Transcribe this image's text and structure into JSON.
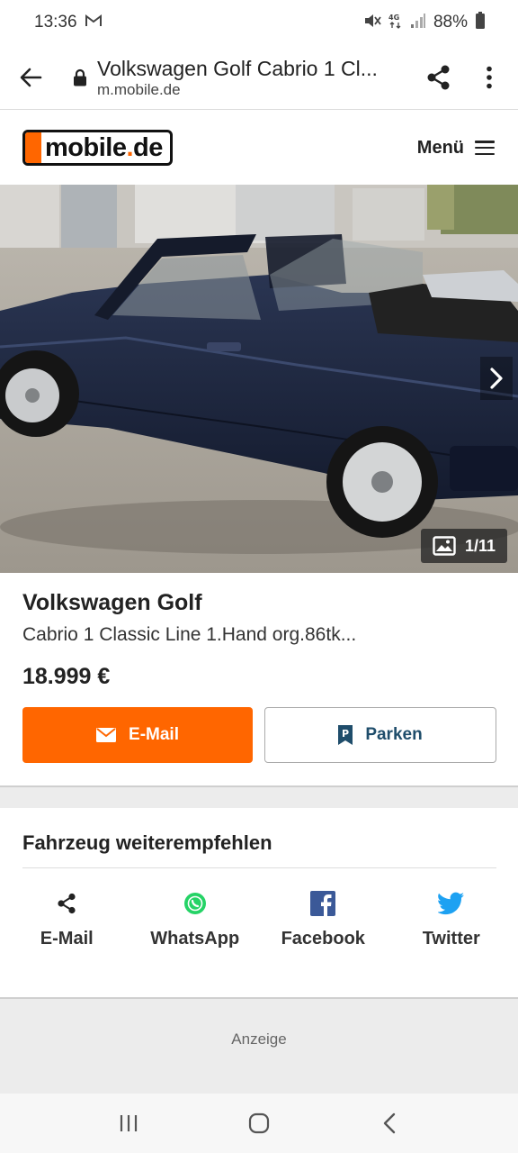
{
  "status_bar": {
    "time": "13:36",
    "battery": "88%",
    "icons": [
      "gmail-icon",
      "mute-icon",
      "4g-icon",
      "signal-icon",
      "battery-icon"
    ]
  },
  "browser": {
    "page_title": "Volkswagen Golf Cabrio 1 Cl...",
    "domain": "m.mobile.de",
    "icons": [
      "back-arrow-icon",
      "lock-icon",
      "share-icon",
      "more-vert-icon"
    ]
  },
  "site_header": {
    "logo_main": "mobile",
    "logo_dot": ".",
    "logo_tld": "de",
    "menu_label": "Menü"
  },
  "gallery": {
    "counter": "1/11"
  },
  "listing": {
    "title": "Volkswagen Golf",
    "subtitle": "Cabrio 1 Classic Line 1.Hand org.86tk...",
    "price": "18.999 €",
    "email_button": "E-Mail",
    "park_button": "Parken"
  },
  "recommend": {
    "title": "Fahrzeug weiterempfehlen",
    "items": [
      {
        "label": "E-Mail",
        "icon": "share-icon"
      },
      {
        "label": "WhatsApp",
        "icon": "whatsapp-icon"
      },
      {
        "label": "Facebook",
        "icon": "facebook-icon"
      },
      {
        "label": "Twitter",
        "icon": "twitter-icon"
      }
    ]
  },
  "ad": {
    "label": "Anzeige"
  },
  "colors": {
    "brand_orange": "#ff6600",
    "park_text": "#1f4d6b",
    "whatsapp_green": "#25d366",
    "facebook_blue": "#3b5998",
    "twitter_blue": "#1da1f2"
  }
}
